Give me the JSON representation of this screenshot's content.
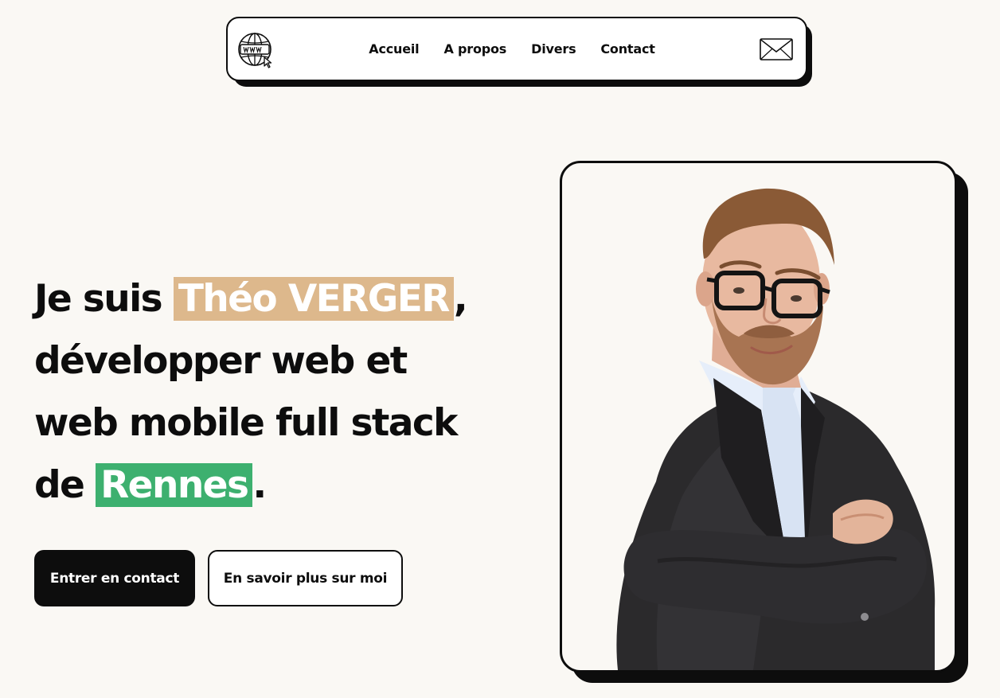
{
  "nav": {
    "logo_icon": "www-globe-icon",
    "links": [
      "Accueil",
      "A propos",
      "Divers",
      "Contact"
    ],
    "mail_icon": "envelope-icon"
  },
  "hero": {
    "line1_prefix": "Je suis ",
    "name": "Théo VERGER",
    "line1_suffix": ",",
    "line2": "développer web et",
    "line3": "web mobile full stack",
    "line4_prefix": "de ",
    "city": "Rennes",
    "line4_suffix": ".",
    "highlight_name_color": "#ddb88c",
    "highlight_city_color": "#3db06f"
  },
  "buttons": {
    "primary": "Entrer en contact",
    "secondary": "En savoir plus sur moi"
  },
  "portrait": {
    "subject": "portrait-photo"
  }
}
